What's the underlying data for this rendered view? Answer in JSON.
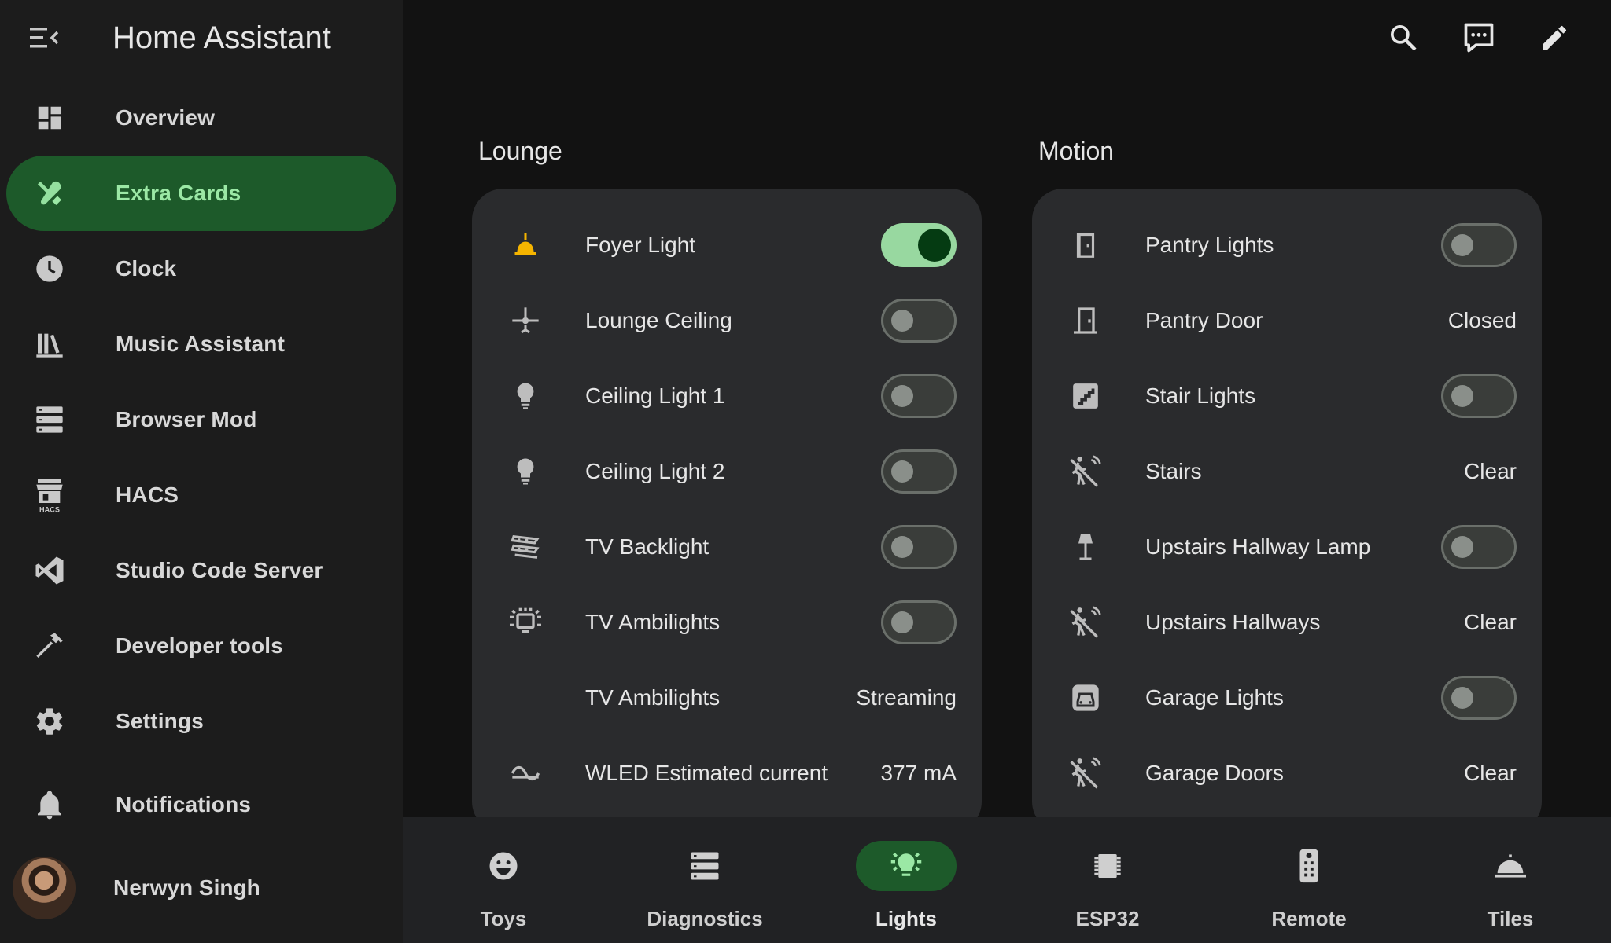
{
  "app": {
    "title": "Home Assistant"
  },
  "colors": {
    "accent": "#1d5a2a",
    "accent_text": "#9be8a5",
    "toggle_on": "#98d8a0",
    "bell_yellow": "#f5b400"
  },
  "sidebar": {
    "items": [
      {
        "label": "Overview",
        "icon": "dashboard-icon"
      },
      {
        "label": "Extra Cards",
        "icon": "tools-icon",
        "active": true
      },
      {
        "label": "Clock",
        "icon": "clock-icon"
      },
      {
        "label": "Music Assistant",
        "icon": "library-music-icon"
      },
      {
        "label": "Browser Mod",
        "icon": "server-icon"
      },
      {
        "label": "HACS",
        "icon": "hacs-icon",
        "icon_text": "HACS"
      },
      {
        "label": "Studio Code Server",
        "icon": "vscode-icon"
      },
      {
        "label": "Developer tools",
        "icon": "hammer-icon"
      },
      {
        "label": "Settings",
        "icon": "cog-icon"
      },
      {
        "label": "Notifications",
        "icon": "bell-icon"
      }
    ],
    "user": {
      "name": "Nerwyn Singh"
    }
  },
  "cards": {
    "lounge": {
      "title": "Lounge",
      "rows": [
        {
          "name": "Foyer Light",
          "icon": "ceiling-bell-icon",
          "toggle": true
        },
        {
          "name": "Lounge Ceiling",
          "icon": "ceiling-fan-light-icon",
          "toggle": false
        },
        {
          "name": "Ceiling Light 1",
          "icon": "lightbulb-icon",
          "toggle": false
        },
        {
          "name": "Ceiling Light 2",
          "icon": "lightbulb-icon",
          "toggle": false
        },
        {
          "name": "TV Backlight",
          "icon": "led-strip-icon",
          "toggle": false
        },
        {
          "name": "TV Ambilights",
          "icon": "tv-ambilight-icon",
          "toggle": false
        },
        {
          "name": "TV Ambilights",
          "state": "Streaming"
        },
        {
          "name": "WLED Estimated current",
          "icon": "current-ac-icon",
          "state": "377 mA"
        }
      ]
    },
    "motion": {
      "title": "Motion",
      "rows": [
        {
          "name": "Pantry Lights",
          "icon": "door-icon",
          "toggle": false
        },
        {
          "name": "Pantry Door",
          "icon": "door-closed-icon",
          "state": "Closed"
        },
        {
          "name": "Stair Lights",
          "icon": "stairs-icon",
          "toggle": false
        },
        {
          "name": "Stairs",
          "icon": "motion-sensor-off-icon",
          "state": "Clear"
        },
        {
          "name": "Upstairs Hallway Lamp",
          "icon": "floor-lamp-icon",
          "toggle": false
        },
        {
          "name": "Upstairs Hallways",
          "icon": "motion-sensor-off-icon",
          "state": "Clear"
        },
        {
          "name": "Garage Lights",
          "icon": "garage-car-icon",
          "toggle": false
        },
        {
          "name": "Garage Doors",
          "icon": "motion-sensor-off-icon",
          "state": "Clear"
        }
      ]
    }
  },
  "bottom_nav": {
    "tabs": [
      {
        "label": "Toys",
        "icon": "emoticon-icon"
      },
      {
        "label": "Diagnostics",
        "icon": "server-icon"
      },
      {
        "label": "Lights",
        "icon": "lights-icon",
        "active": true
      },
      {
        "label": "ESP32",
        "icon": "chip-icon"
      },
      {
        "label": "Remote",
        "icon": "remote-icon"
      },
      {
        "label": "Tiles",
        "icon": "room-service-icon"
      }
    ]
  }
}
